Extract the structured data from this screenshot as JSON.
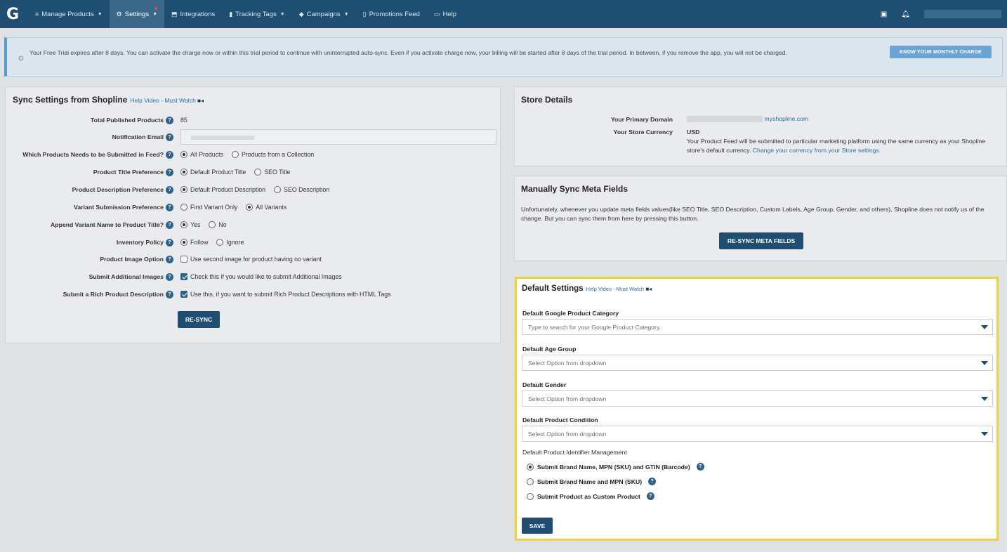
{
  "nav": {
    "logo": "G",
    "items": [
      {
        "label": "Manage Products",
        "icon": "≡"
      },
      {
        "label": "Settings",
        "icon": "⚙"
      },
      {
        "label": "Integrations",
        "icon": "⬒"
      },
      {
        "label": "Tracking Tags",
        "icon": "▮"
      },
      {
        "label": "Campaigns",
        "icon": "◆"
      },
      {
        "label": "Promotions Feed",
        "icon": "▯"
      },
      {
        "label": "Help",
        "icon": "▭"
      }
    ]
  },
  "banner": {
    "text": "Your Free Trial expires after 8 days. You can activate the charge now or within this trial period to continue with uninterrupted auto-sync. Even if you activate charge now, your billing will be started after 8 days of the trial period. In between, if you remove the app, you will not be charged.",
    "button": "KNOW YOUR MONTHLY CHARGE"
  },
  "sync": {
    "title": "Sync Settings from Shopline",
    "help_link": "Help Video - Must Watch",
    "rows": {
      "total_label": "Total Published Products",
      "total_value": "85",
      "email_label": "Notification Email",
      "which_label": "Which Products Needs to be Submitted in Feed?",
      "which_opt1": "All Products",
      "which_opt2": "Products from a Collection",
      "title_label": "Product Title Preference",
      "title_opt1": "Default Product Title",
      "title_opt2": "SEO Title",
      "desc_label": "Product Description Preference",
      "desc_opt1": "Default Product Description",
      "desc_opt2": "SEO Description",
      "variant_label": "Variant Submission Preference",
      "variant_opt1": "First Variant Only",
      "variant_opt2": "All Variants",
      "append_label": "Append Variant Name to Product Title?",
      "append_opt1": "Yes",
      "append_opt2": "No",
      "inventory_label": "Inventory Policy",
      "inventory_opt1": "Follow",
      "inventory_opt2": "Ignore",
      "image_label": "Product Image Option",
      "image_text": "Use second image for product having no variant",
      "additional_label": "Submit Additional Images",
      "additional_text": "Check this if you would like to submit Additional Images",
      "rich_label": "Submit a Rich Product Description",
      "rich_text": "Use this, if you want to submit Rich Product Descriptions with HTML Tags"
    },
    "button": "RE-SYNC"
  },
  "store": {
    "title": "Store Details",
    "domain_label": "Your Primary Domain",
    "domain_value": "myshopline.com",
    "currency_label": "Your Store Currency",
    "currency_value": "USD",
    "currency_note": "Your Product Feed will be submitted to particular marketing platform using the same currency as your Shopline store's default currency.",
    "currency_link": "Change your currency from your Store settings."
  },
  "meta": {
    "title": "Manually Sync Meta Fields",
    "text": "Unfortunately, whenever you update meta fields values(like SEO Title, SEO Description, Custom Labels, Age Group, Gender, and others), Shopline does not notify us of the change. But you can sync them from here by pressing this button.",
    "button": "RE-SYNC META FIELDS"
  },
  "defaults": {
    "title": "Default Settings",
    "help_link": "Help Video - Must Watch",
    "category_label": "Default Google Product Category",
    "category_placeholder": "Type to search for your Google Product Category.",
    "age_label": "Default Age Group",
    "age_placeholder": "Select Option from dropdown",
    "gender_label": "Default Gender",
    "gender_placeholder": "Select Option from dropdown",
    "condition_label": "Default Product Condition",
    "condition_placeholder": "Select Option from dropdown",
    "identifier_label": "Default Product Identifier Management",
    "identifier_opt1": "Submit Brand Name, MPN (SKU) and GTIN (Barcode)",
    "identifier_opt2": "Submit Brand Name and MPN (SKU)",
    "identifier_opt3": "Submit Product as Custom Product",
    "save": "SAVE"
  }
}
